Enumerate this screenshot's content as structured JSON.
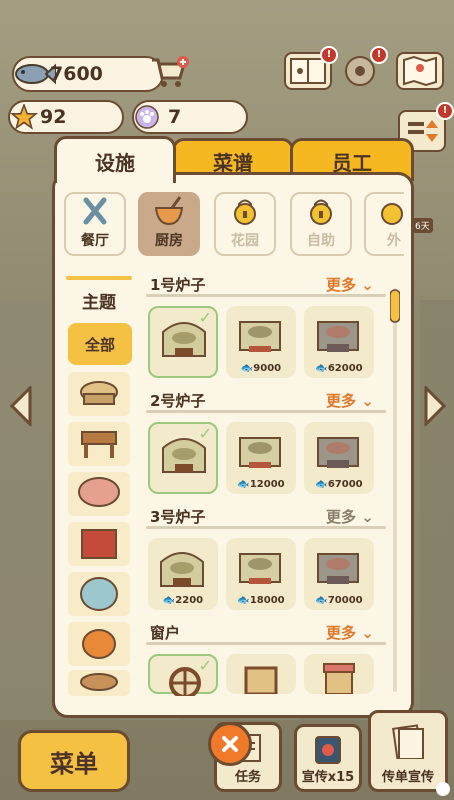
{
  "currency": {
    "fish": "7600",
    "stars": "92",
    "gems": "7"
  },
  "tabs": [
    "设施",
    "菜谱",
    "员工"
  ],
  "categories": [
    {
      "label": "餐厅",
      "icon": "utensils-icon",
      "locked": false
    },
    {
      "label": "厨房",
      "icon": "mixing-bowl-icon",
      "locked": false
    },
    {
      "label": "花园",
      "icon": "lock-icon",
      "locked": true
    },
    {
      "label": "自助",
      "icon": "lock-icon",
      "locked": true
    },
    {
      "label": "外",
      "icon": "lock-icon",
      "locked": true
    }
  ],
  "sidebar": {
    "title": "主题",
    "all_label": "全部"
  },
  "sections": [
    {
      "title": "1号炉子",
      "more": "更多",
      "prices": [
        "",
        "9000",
        "62000"
      ]
    },
    {
      "title": "2号炉子",
      "more": "更多",
      "prices": [
        "",
        "12000",
        "67000"
      ]
    },
    {
      "title": "3号炉子",
      "more": "更多",
      "prices": [
        "2200",
        "18000",
        "70000"
      ]
    },
    {
      "title": "窗户",
      "more": "更多",
      "prices": [
        "",
        "",
        ""
      ]
    }
  ],
  "bottom": {
    "menu": "菜单",
    "task": "任务",
    "promo": "宣传x15",
    "flyer": "传单宣传"
  },
  "side_note": "6天",
  "colors": {
    "tab_inactive": "#f5b821",
    "accent_more": "#e2782a",
    "panel_bg": "#fbf6e6",
    "border": "#6b4b32"
  }
}
